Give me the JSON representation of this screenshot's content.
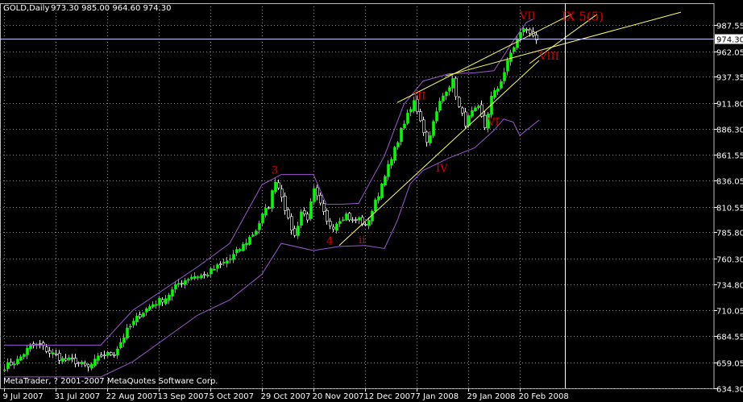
{
  "header": {
    "symbol": "GOLD,Daily",
    "ohlc": "973.30 985.00 964.60 974.30"
  },
  "copyright": "MetaTrader, ? 2001-2007 MetaQuotes Software Corp.",
  "colors": {
    "background": "#000000",
    "grid": "#8a8a8a",
    "bull_candle": "#00ff00",
    "bear_candle": "#ffffff",
    "bollinger": "#9b59d0",
    "trendline": "#ffff66",
    "wave_label": "#ff0000",
    "current_price_bg": "#ffffff",
    "current_price_line": "#c8c8ff"
  },
  "chart_data": {
    "type": "candlestick",
    "y_ticks": [
      "987.55",
      "962.05",
      "937.35",
      "911.80",
      "886.30",
      "861.55",
      "836.05",
      "810.55",
      "785.80",
      "760.30",
      "734.80",
      "710.05",
      "684.55",
      "659.05",
      "634.30"
    ],
    "ylim": [
      630,
      1000
    ],
    "current_price": "974.30",
    "x_ticks": [
      {
        "label": "9 Jul 2007",
        "bar": 0
      },
      {
        "label": "31 Jul 2007",
        "bar": 16
      },
      {
        "label": "22 Aug 2007",
        "bar": 32
      },
      {
        "label": "13 Sep 2007",
        "bar": 48
      },
      {
        "label": "5 Oct 2007",
        "bar": 64
      },
      {
        "label": "29 Oct 2007",
        "bar": 80
      },
      {
        "label": "20 Nov 2007",
        "bar": 96
      },
      {
        "label": "12 Dec 2007",
        "bar": 112
      },
      {
        "label": "7 Jan 2008",
        "bar": 128
      },
      {
        "label": "29 Jan 2008",
        "bar": 144
      },
      {
        "label": "20 Feb 2008",
        "bar": 160
      }
    ],
    "anchors": [
      [
        0,
        655
      ],
      [
        4,
        661
      ],
      [
        8,
        675
      ],
      [
        11,
        676
      ],
      [
        14,
        669
      ],
      [
        18,
        662
      ],
      [
        22,
        660
      ],
      [
        26,
        654
      ],
      [
        30,
        666
      ],
      [
        34,
        668
      ],
      [
        38,
        690
      ],
      [
        42,
        706
      ],
      [
        46,
        716
      ],
      [
        50,
        722
      ],
      [
        54,
        736
      ],
      [
        58,
        743
      ],
      [
        62,
        744
      ],
      [
        66,
        752
      ],
      [
        70,
        760
      ],
      [
        74,
        773
      ],
      [
        78,
        788
      ],
      [
        80,
        802
      ],
      [
        82,
        812
      ],
      [
        84,
        837
      ],
      [
        86,
        822
      ],
      [
        88,
        797
      ],
      [
        90,
        782
      ],
      [
        92,
        806
      ],
      [
        94,
        800
      ],
      [
        96,
        826
      ],
      [
        98,
        812
      ],
      [
        100,
        795
      ],
      [
        102,
        792
      ],
      [
        104,
        799
      ],
      [
        106,
        803
      ],
      [
        108,
        796
      ],
      [
        110,
        799
      ],
      [
        112,
        791
      ],
      [
        114,
        807
      ],
      [
        116,
        823
      ],
      [
        118,
        843
      ],
      [
        120,
        856
      ],
      [
        122,
        876
      ],
      [
        124,
        893
      ],
      [
        126,
        905
      ],
      [
        127,
        913
      ],
      [
        129,
        896
      ],
      [
        131,
        873
      ],
      [
        133,
        892
      ],
      [
        135,
        912
      ],
      [
        137,
        925
      ],
      [
        139,
        933
      ],
      [
        141,
        907
      ],
      [
        143,
        892
      ],
      [
        145,
        902
      ],
      [
        147,
        906
      ],
      [
        149,
        888
      ],
      [
        151,
        917
      ],
      [
        153,
        926
      ],
      [
        155,
        942
      ],
      [
        157,
        960
      ],
      [
        159,
        973
      ],
      [
        161,
        985
      ],
      [
        162,
        981
      ],
      [
        164,
        979
      ],
      [
        165,
        974
      ]
    ],
    "bb_upper": [
      [
        0,
        676
      ],
      [
        14,
        676
      ],
      [
        30,
        676
      ],
      [
        40,
        710
      ],
      [
        60,
        752
      ],
      [
        70,
        775
      ],
      [
        80,
        832
      ],
      [
        86,
        842
      ],
      [
        96,
        842
      ],
      [
        100,
        813
      ],
      [
        104,
        813
      ],
      [
        110,
        814
      ],
      [
        118,
        860
      ],
      [
        124,
        910
      ],
      [
        130,
        933
      ],
      [
        138,
        940
      ],
      [
        146,
        941
      ],
      [
        152,
        943
      ],
      [
        158,
        972
      ],
      [
        162,
        990
      ],
      [
        164,
        993
      ]
    ],
    "bb_lower": [
      [
        0,
        645
      ],
      [
        14,
        645
      ],
      [
        30,
        645
      ],
      [
        40,
        660
      ],
      [
        60,
        705
      ],
      [
        70,
        720
      ],
      [
        80,
        745
      ],
      [
        86,
        775
      ],
      [
        96,
        768
      ],
      [
        104,
        772
      ],
      [
        112,
        773
      ],
      [
        118,
        770
      ],
      [
        122,
        797
      ],
      [
        126,
        833
      ],
      [
        130,
        846
      ],
      [
        138,
        858
      ],
      [
        146,
        868
      ],
      [
        152,
        885
      ],
      [
        155,
        896
      ],
      [
        158,
        893
      ],
      [
        160,
        880
      ],
      [
        164,
        890
      ],
      [
        166,
        895
      ]
    ],
    "trendlines": [
      [
        [
          104,
          773
        ],
        [
          166,
          953
        ]
      ],
      [
        [
          122,
          912
        ],
        [
          176,
          998
        ]
      ],
      [
        [
          137,
          938
        ],
        [
          210,
          1000
        ]
      ],
      [
        [
          163,
          950
        ],
        [
          184,
          998
        ]
      ]
    ],
    "wave_labels": [
      {
        "text": "3",
        "bar": 84,
        "price": 843,
        "size": 13
      },
      {
        "text": "4",
        "bar": 101,
        "price": 774,
        "size": 13
      },
      {
        "text": "ii",
        "bar": 111,
        "price": 775,
        "size": 13
      },
      {
        "text": "III",
        "bar": 128,
        "price": 915,
        "size": 13
      },
      {
        "text": "IV",
        "bar": 135,
        "price": 845,
        "size": 13
      },
      {
        "text": "VI",
        "bar": 151,
        "price": 890,
        "size": 13
      },
      {
        "text": "VII",
        "bar": 161,
        "price": 993,
        "size": 13
      },
      {
        "text": "VIII",
        "bar": 167,
        "price": 954,
        "size": 13
      },
      {
        "text": "IX 5(5)",
        "bar": 174,
        "price": 992,
        "size": 15
      }
    ],
    "current_time_line_bar": 174
  }
}
